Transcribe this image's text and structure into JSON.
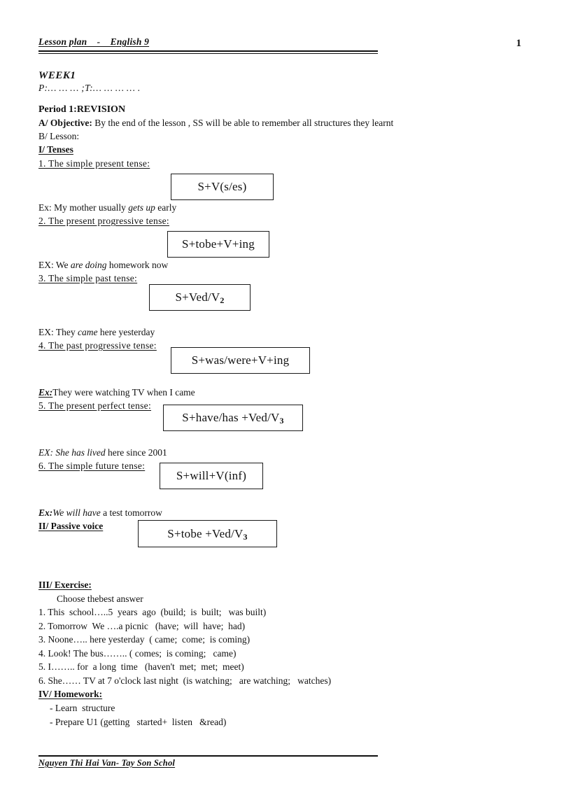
{
  "header": {
    "title": "Lesson plan    -    English 9",
    "page_number": "1"
  },
  "week": {
    "label": "WEEK1",
    "pt_line": "P:… … … ;T:… … … … ."
  },
  "period": {
    "title": "Period 1:REVISION",
    "objective_label": "A/ Objective:",
    "objective_text": "  By the end of the lesson , SS will  be able to  remember  all  structures  they learnt",
    "lesson_label": "B/ Lesson:"
  },
  "sections": {
    "tenses_heading": "I/ Tenses",
    "passive_heading": "II/ Passive voice",
    "exercise_heading": "III/ Exercise:  ",
    "homework_heading": "IV/ Homework: "
  },
  "tenses": [
    {
      "heading": "1. The  simple  present tense:",
      "structure": "S+V(s/es)",
      "example_prefix": "  Ex: My mother  usually  ",
      "example_italic": "gets up",
      "example_suffix": " early"
    },
    {
      "heading": "2. The  present  progressive  tense:",
      "structure": "S+tobe+V+ing",
      "example_prefix": "EX: We ",
      "example_italic": "are doing",
      "example_suffix": " homework  now"
    },
    {
      "heading": "3. The  simple  past tense:",
      "structure": "S+Ved/V",
      "structure_sub": "2",
      "example_prefix": " EX: They ",
      "example_italic": "came",
      "example_suffix": " here  yesterday"
    },
    {
      "heading": "4. The  past progressive  tense:",
      "structure": "S+was/were+V+ing",
      "example_prefix": "Ex:",
      "example_italic": "",
      "example_suffix": "They  were watching  TV  when  I came"
    },
    {
      "heading": "5. The  present perfect tense:",
      "structure": "S+have/has +Ved/V",
      "structure_sub": "3",
      "example_prefix": "EX: She ",
      "example_italic": "has lived",
      "example_suffix": " here  since  2001"
    },
    {
      "heading": "6. The  simple  future  tense:",
      "structure": "S+will+V(inf)",
      "example_prefix": "Ex:",
      "example_italic": "We will have",
      "example_suffix": " a test  tomorrow"
    }
  ],
  "passive": {
    "structure": "S+tobe +Ved/V",
    "structure_sub": "3"
  },
  "exercise": {
    "instruction": "Choose thebest answer",
    "questions": [
      "1. This  school…..5  years  ago  (build;  is  built;   was built)",
      "2. Tomorrow  We ….a picnic   (have;  will  have;  had)",
      "3. Noone….. here yesterday  ( came;  come;  is coming)",
      "4. Look! The bus…….. ( comes;  is coming;   came)",
      "5. I…….. for  a long  time   (haven't  met;  met;  meet)",
      "6. She…… TV at 7 o'clock last night  (is watching;   are watching;   watches)"
    ]
  },
  "homework": {
    "items": [
      "- Learn  structure",
      "- Prepare U1 (getting   started+  listen   &read)"
    ]
  },
  "footer": {
    "text": "Nguyen Thi Hai Van- Tay Son Schol"
  }
}
